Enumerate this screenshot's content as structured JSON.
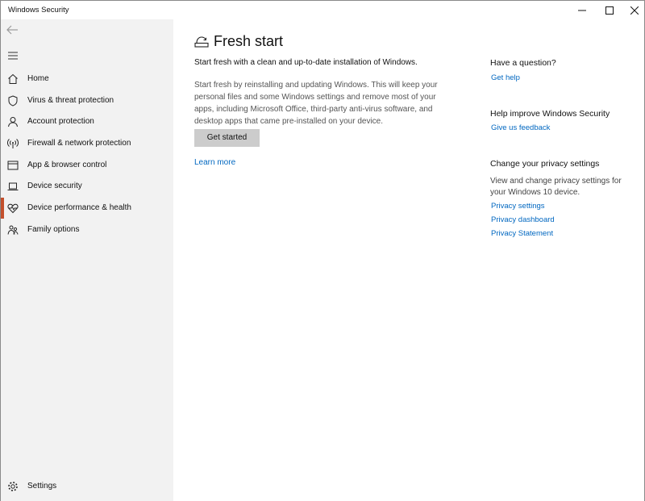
{
  "window": {
    "title": "Windows Security"
  },
  "sidebar": {
    "items": [
      {
        "label": "Home",
        "icon": "home-icon"
      },
      {
        "label": "Virus & threat protection",
        "icon": "shield-icon"
      },
      {
        "label": "Account protection",
        "icon": "person-icon"
      },
      {
        "label": "Firewall & network protection",
        "icon": "antenna-icon"
      },
      {
        "label": "App & browser control",
        "icon": "browser-window-icon"
      },
      {
        "label": "Device security",
        "icon": "laptop-icon"
      },
      {
        "label": "Device performance & health",
        "icon": "heart-pulse-icon",
        "active": true
      },
      {
        "label": "Family options",
        "icon": "family-icon"
      }
    ],
    "settings_label": "Settings",
    "active_color": "#c3502c"
  },
  "main": {
    "title": "Fresh start",
    "title_icon": "fresh-start-icon",
    "intro": "Start fresh with a clean and up-to-date installation of Windows.",
    "description": "Start fresh by reinstalling and updating Windows. This will keep your personal files and some Windows settings and remove most of your apps, including Microsoft Office, third-party anti-virus software, and desktop apps that came pre-installed on your device.",
    "get_started_label": "Get started",
    "learn_more_label": "Learn more"
  },
  "right": {
    "question_heading": "Have a question?",
    "get_help_label": "Get help",
    "improve_heading": "Help improve Windows Security",
    "feedback_label": "Give us feedback",
    "privacy_heading": "Change your privacy settings",
    "privacy_text": "View and change privacy settings for your Windows 10 device.",
    "privacy_settings_label": "Privacy settings",
    "privacy_dashboard_label": "Privacy dashboard",
    "privacy_statement_label": "Privacy Statement"
  },
  "colors": {
    "link": "#0067c0",
    "button_bg": "#cccccc",
    "sidebar_bg": "#f2f2f2"
  }
}
